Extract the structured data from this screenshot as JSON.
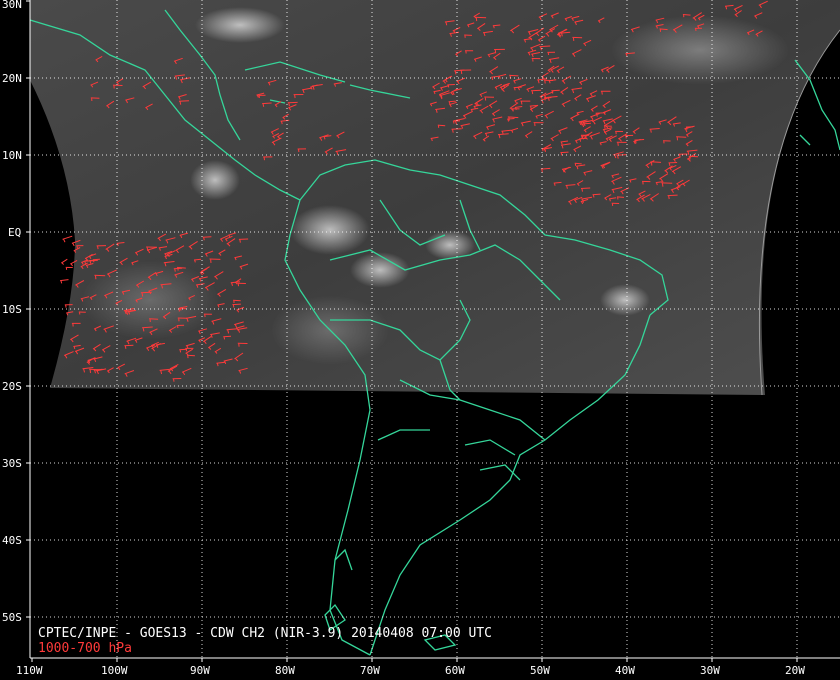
{
  "product": {
    "caption": "CPTEC/INPE - GOES13 - CDW CH2 (NIR-3.9) 20140408 07:00 UTC",
    "level": "1000-700 hPa"
  },
  "axes": {
    "latitude_labels": [
      "30N",
      "20N",
      "10N",
      "EQ",
      "10S",
      "20S",
      "30S",
      "40S",
      "50S"
    ],
    "longitude_labels": [
      "110W",
      "100W",
      "90W",
      "80W",
      "70W",
      "60W",
      "50W",
      "40W",
      "30W",
      "20W"
    ]
  },
  "colors": {
    "background": "#000000",
    "coastline": "#35d69a",
    "wind_barbs": "#ff3a3a",
    "grid": "#ffffff",
    "labels": "#ffffff",
    "level_text": "#ff3a3a"
  }
}
